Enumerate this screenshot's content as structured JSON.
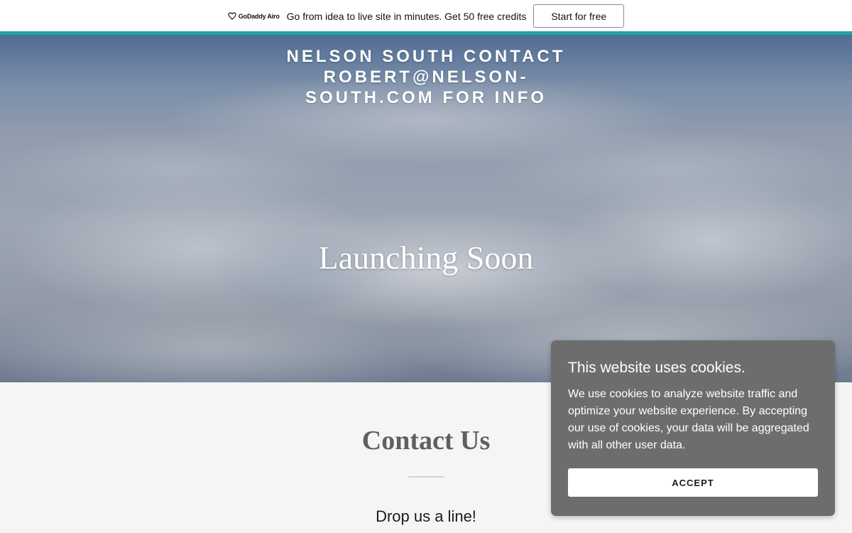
{
  "promo_bar": {
    "logo_text": "GoDaddy Airo",
    "message": "Go from idea to live site in minutes. Get 50 free credits",
    "cta_label": "Start for free",
    "accent_color": "#1ba3a3"
  },
  "hero": {
    "title": "NELSON SOUTH CONTACT ROBERT@NELSON-SOUTH.COM FOR INFO",
    "headline": "Launching Soon"
  },
  "contact": {
    "title": "Contact Us",
    "subtitle": "Drop us a line!"
  },
  "cookie_dialog": {
    "title": "This website uses cookies.",
    "body": "We use cookies to analyze website traffic and optimize your website experience. By accepting our use of cookies, your data will be aggregated with all other user data.",
    "accept_label": "ACCEPT"
  }
}
